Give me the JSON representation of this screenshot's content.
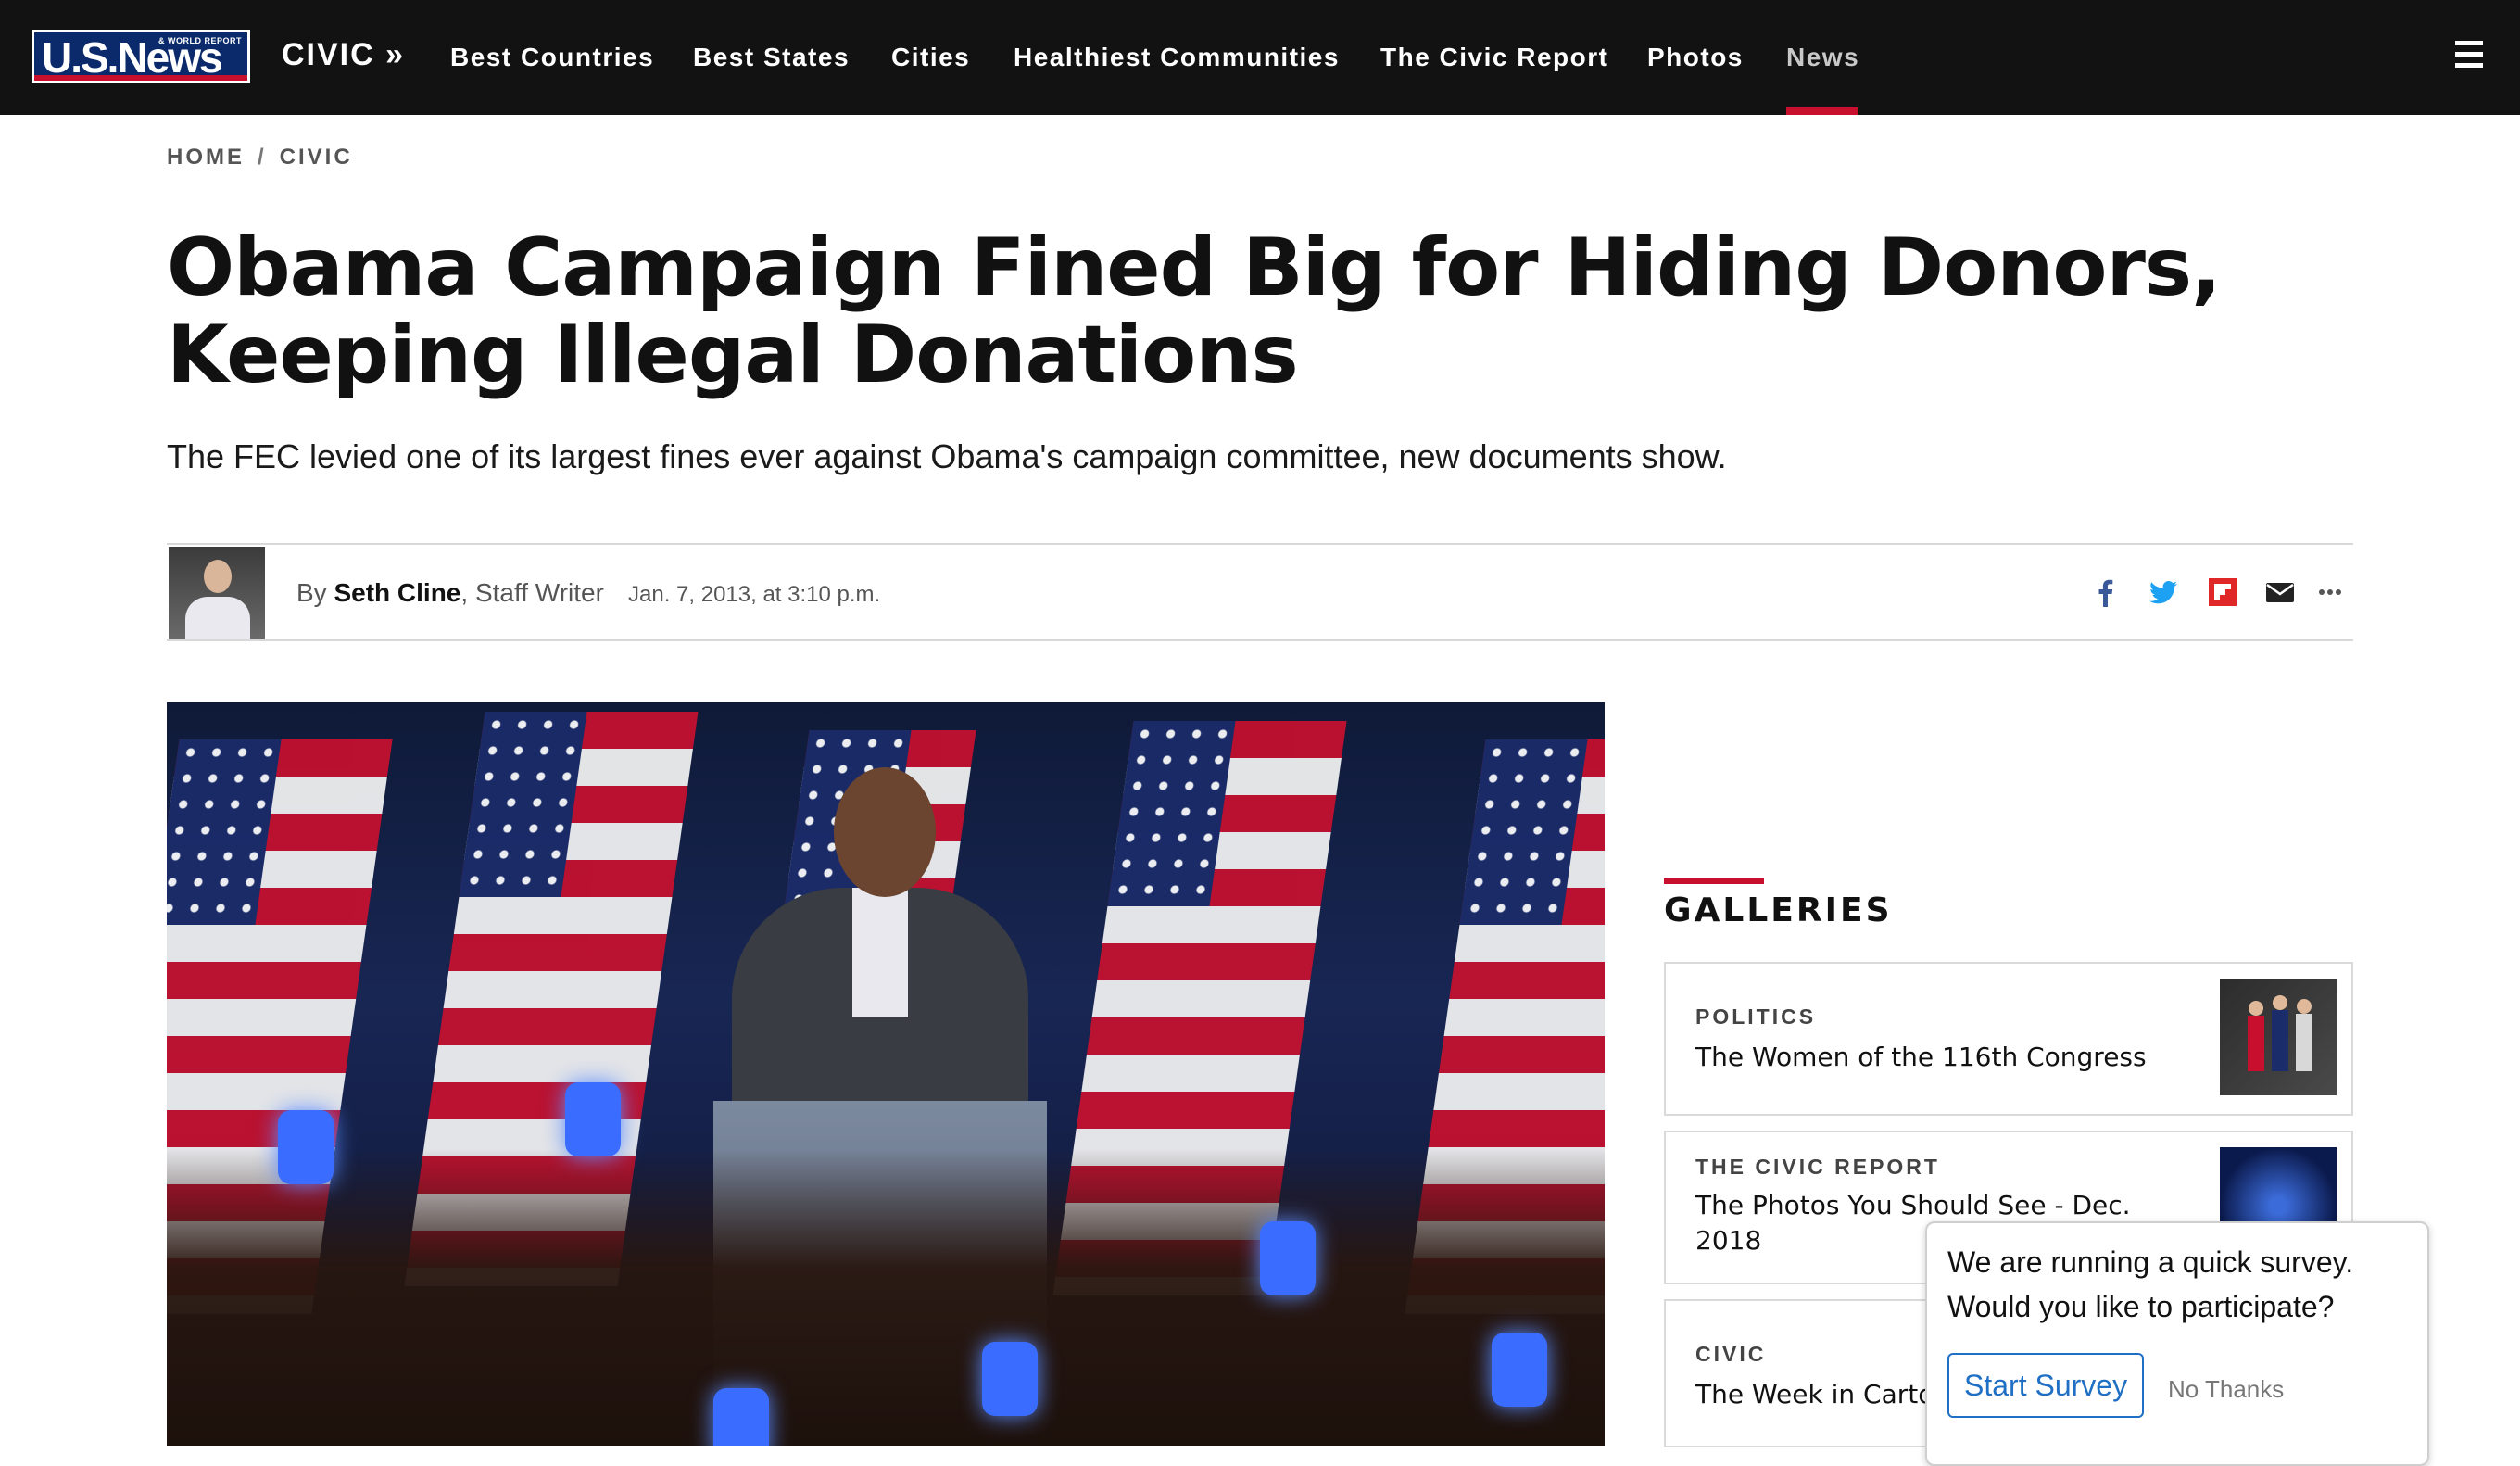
{
  "brand": {
    "logo_text": "U.S.News",
    "logo_subtext": "& WORLD REPORT",
    "accent": "#c8102e",
    "navy": "#0a2a6b"
  },
  "nav": {
    "section": "CIVIC »",
    "items": [
      "Best Countries",
      "Best States",
      "Cities",
      "Healthiest Communities",
      "The Civic Report",
      "Photos",
      "News"
    ],
    "active": "News"
  },
  "breadcrumb": [
    "HOME",
    "CIVIC"
  ],
  "breadcrumb_sep": "/",
  "article": {
    "headline": "Obama Campaign Fined Big for Hiding Donors, Keeping Illegal Donations",
    "dek": "The FEC levied one of its largest fines ever against Obama's campaign committee, new documents show.",
    "by_prefix": "By",
    "author": "Seth Cline",
    "author_role": ", Staff Writer",
    "date": "Jan. 7, 2013, at 3:10 p.m."
  },
  "share_icons": [
    "facebook-icon",
    "twitter-icon",
    "flipboard-icon",
    "email-icon",
    "more-icon"
  ],
  "galleries": {
    "title": "GALLERIES",
    "cards": [
      {
        "kicker": "POLITICS",
        "title": "The Women of the 116th Congress"
      },
      {
        "kicker": "THE CIVIC REPORT",
        "title": "The Photos You Should See - Dec. 2018"
      },
      {
        "kicker": "CIVIC",
        "title": "The Week in Carto"
      }
    ]
  },
  "survey": {
    "message": "We are running a quick survey. Would you like to participate?",
    "start_label": "Start Survey",
    "decline_label": "No Thanks"
  }
}
